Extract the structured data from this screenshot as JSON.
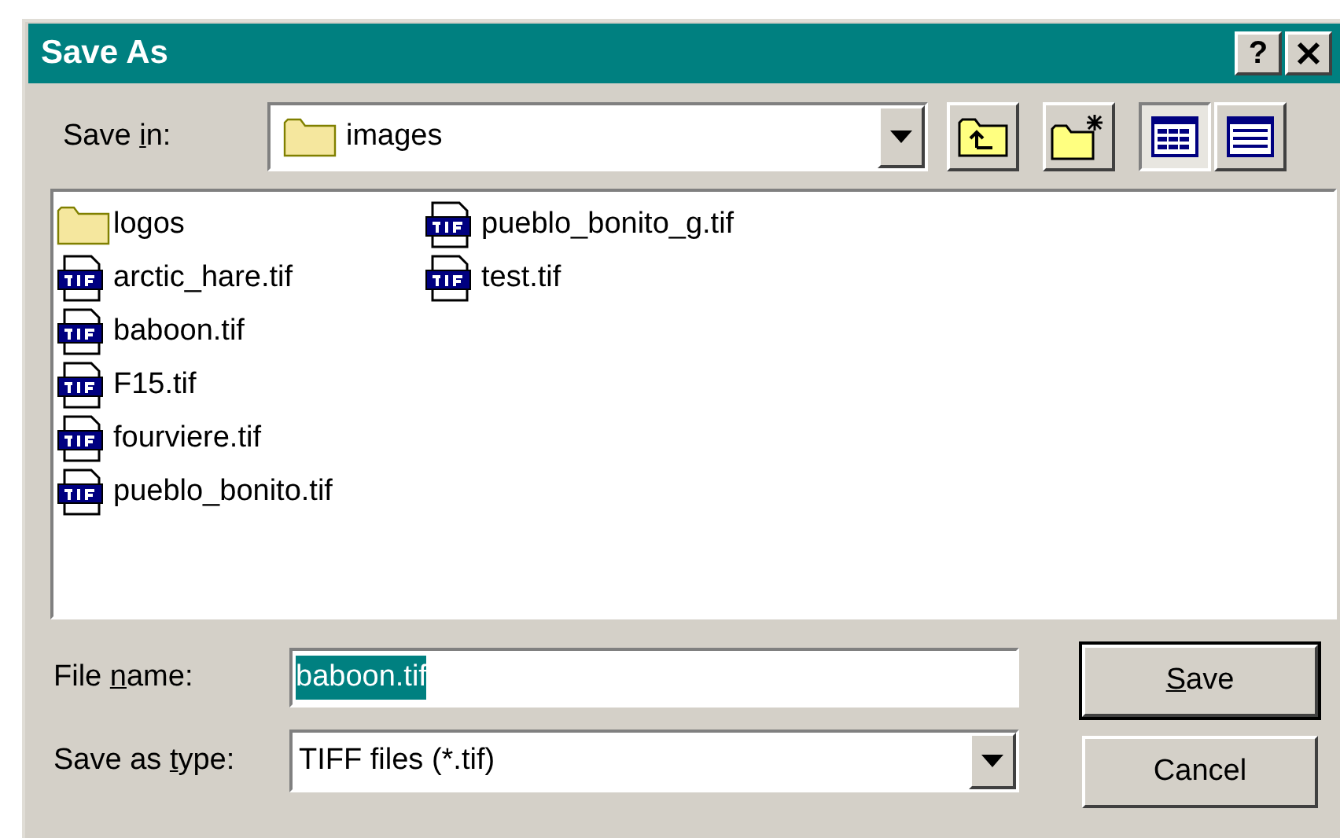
{
  "window": {
    "title": "Save As",
    "help_label": "?"
  },
  "save_in": {
    "label": [
      {
        "text": "Save "
      },
      {
        "text": "i",
        "underlined": true
      },
      {
        "text": "n:"
      }
    ],
    "value": "images"
  },
  "toolbar": [
    {
      "kind": "up"
    },
    {
      "kind": "new-folder"
    },
    {
      "kind": "list",
      "selected": true
    },
    {
      "kind": "details",
      "selected": false
    }
  ],
  "files": [
    {
      "name": "logos",
      "kind": "folder"
    },
    {
      "name": "arctic_hare.tif",
      "kind": "tif"
    },
    {
      "name": "baboon.tif",
      "kind": "tif"
    },
    {
      "name": "F15.tif",
      "kind": "tif"
    },
    {
      "name": "fourviere.tif",
      "kind": "tif"
    },
    {
      "name": "pueblo_bonito.tif",
      "kind": "tif"
    },
    {
      "name": "pueblo_bonito_g.tif",
      "kind": "tif"
    },
    {
      "name": "test.tif",
      "kind": "tif"
    }
  ],
  "file_name": {
    "label": [
      {
        "text": "File "
      },
      {
        "text": "n",
        "underlined": true
      },
      {
        "text": "ame:"
      }
    ],
    "value": "baboon.tif",
    "text_selected": true
  },
  "save_as_type": {
    "label": [
      {
        "text": "Save as "
      },
      {
        "text": "t",
        "underlined": true
      },
      {
        "text": "ype:"
      }
    ],
    "value": "TIFF files (*.tif)"
  },
  "buttons": [
    {
      "label": [
        {
          "text": "S",
          "underlined": true
        },
        {
          "text": "ave"
        }
      ],
      "default": true
    },
    {
      "label": [
        {
          "text": "Cancel",
          "underlined": false
        }
      ],
      "default": false
    }
  ]
}
